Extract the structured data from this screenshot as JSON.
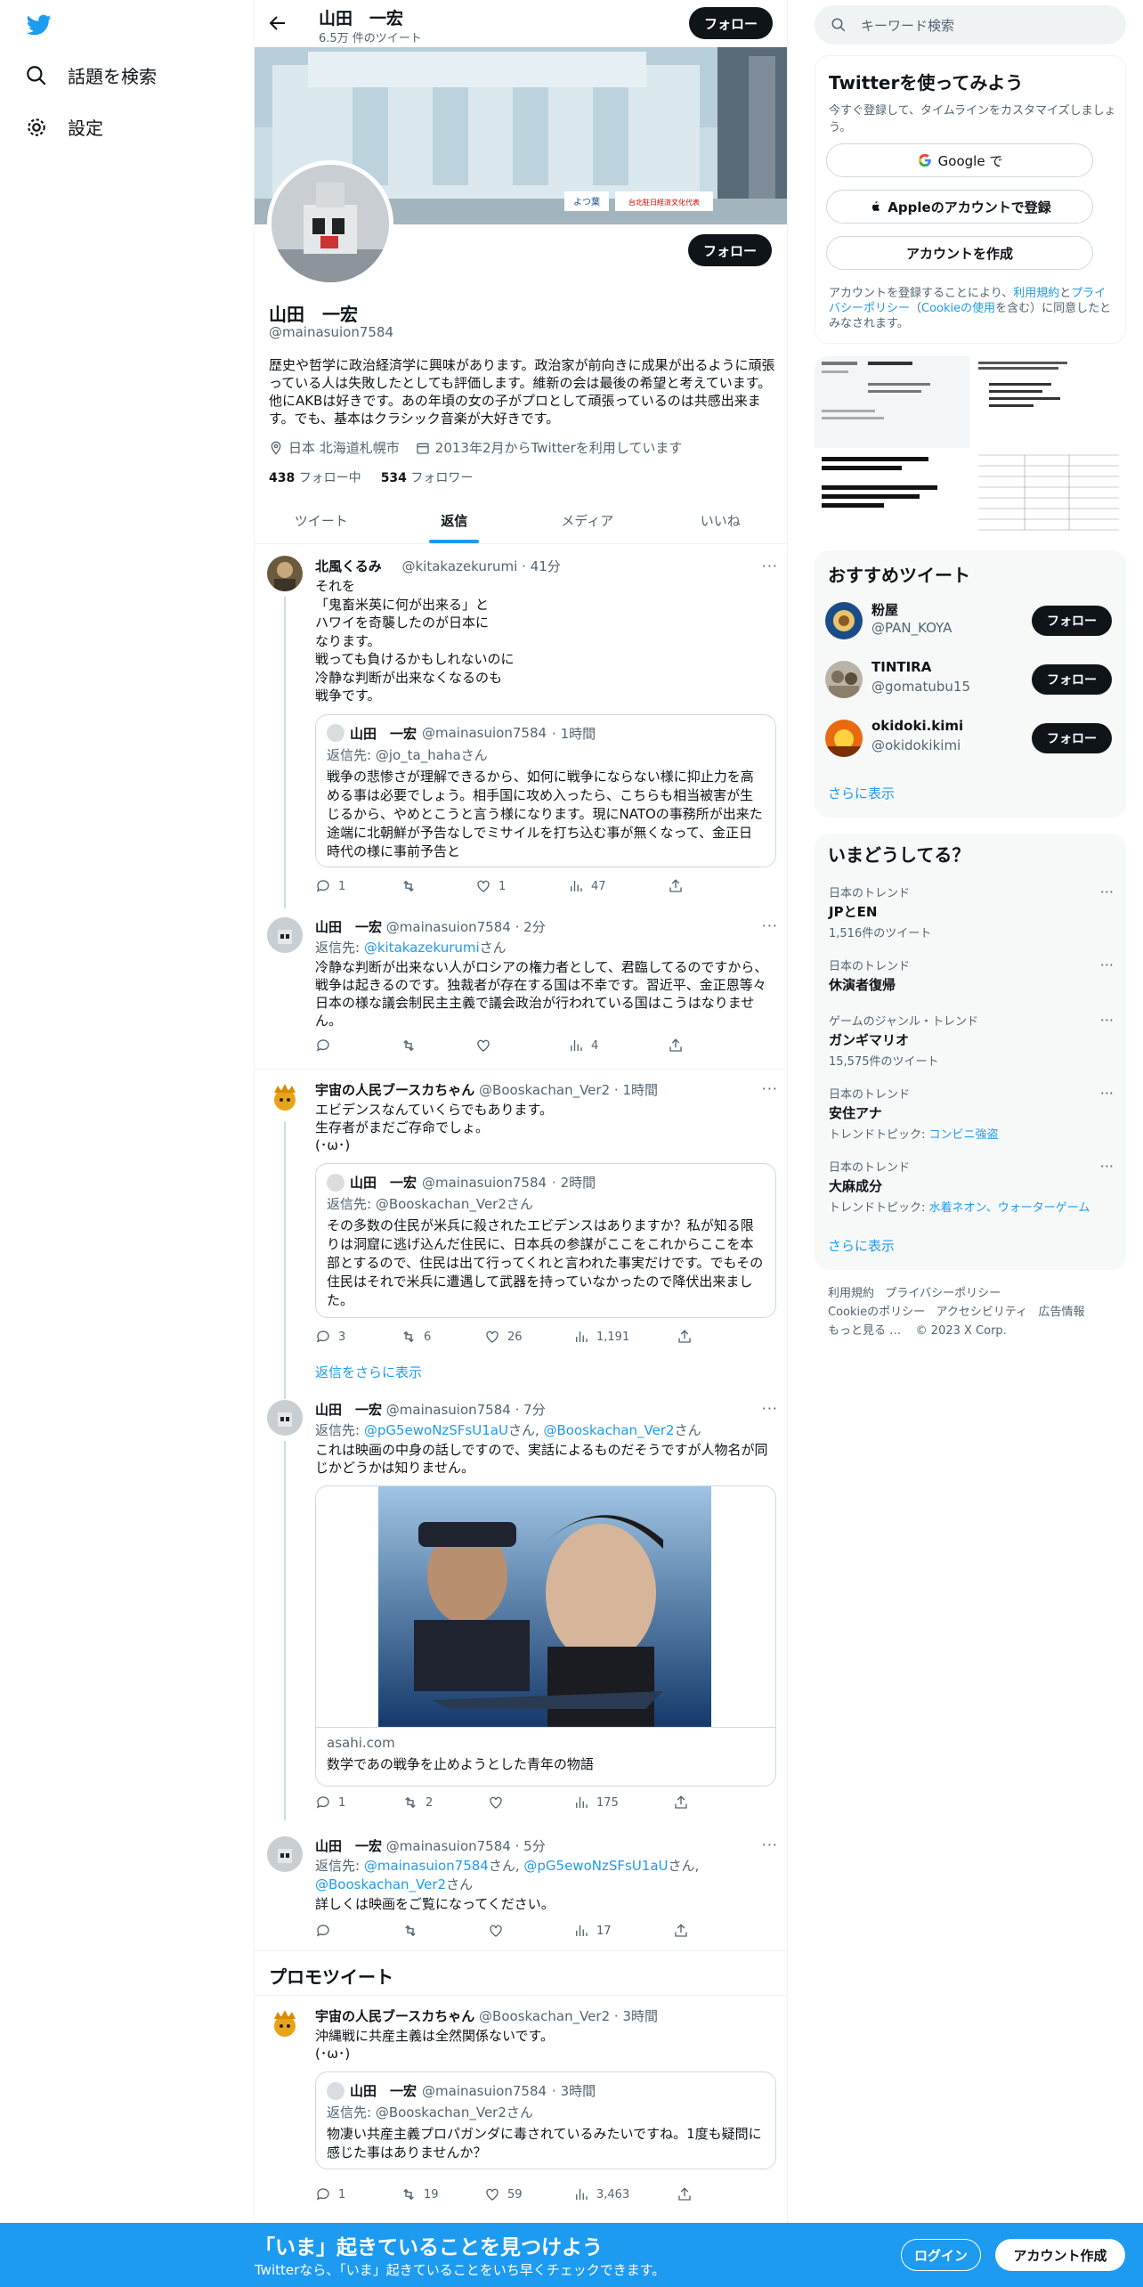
{
  "nav": {
    "explore_label": "話題を検索",
    "settings_label": "設定"
  },
  "topbar": {
    "name": "山田　一宏",
    "tweet_count": "6.5万 件のツイート",
    "follow_label": "フォロー"
  },
  "profile": {
    "name": "山田　一宏",
    "handle": "@mainasuion7584",
    "follow_label": "フォロー",
    "bio": "歴史や哲学に政治経済学に興味があります。政治家が前向きに成果が出るように頑張っている人は失敗したとしても評価します。維新の会は最後の希望と考えています。他にAKBは好きです。あの年頃の女の子がプロとして頑張っているのは共感出来ます。でも、基本はクラシック音楽が大好きです。",
    "location": "日本 北海道札幌市",
    "joined": "2013年2月からTwitterを利用しています",
    "following_count": "438",
    "following_label": "フォロー中",
    "followers_count": "534",
    "followers_label": "フォロワー",
    "banner_sign_1": "よつ葉",
    "banner_sign_2": "台北駐日経済文化代表"
  },
  "tabs": [
    "ツイート",
    "返信",
    "メディア",
    "いいね"
  ],
  "tweets": [
    {
      "name": "北風くるみ",
      "handle": "@kitakazekurumi",
      "time": "· 41分",
      "text": "それを\n「鬼畜米英に何が出来る」と\nハワイを奇襲したのが日本に\nなります。\n戦っても負けるかもしれないのに\n冷静な判断が出来なくなるのも\n戦争です。",
      "quote": {
        "name": "山田　一宏",
        "handle": "@mainasuion7584",
        "time": "· 1時間",
        "reply_to": "返信先: @jo_ta_hahaさん",
        "text": "戦争の悲惨さが理解できるから、如何に戦争にならない様に抑止力を高める事は必要でしょう。相手国に攻め入ったら、こちらも相当被害が生じるから、やめとこうと言う様になります。現にNATOの事務所が出来た途端に北朝鮮が予告なしでミサイルを打ち込む事が無くなって、金正日時代の様に事前予告と"
      },
      "replies": "1",
      "retweets": "",
      "likes": "1",
      "views": "47"
    },
    {
      "name": "山田　一宏",
      "handle": "@mainasuion7584",
      "time": "· 2分",
      "reply_prefix": "返信先: ",
      "reply_link": "@kitakazekurumi",
      "reply_suffix": "さん",
      "text": "冷静な判断が出来ない人がロシアの権力者として、君臨してるのですから、戦争は起きるのです。独裁者が存在する国は不幸です。習近平、金正恩等々日本の様な議会制民主主義で議会政治が行われている国はこうはなりません。",
      "replies": "",
      "retweets": "",
      "likes": "",
      "views": "4"
    },
    {
      "name": "宇宙の人民ブースカちゃん",
      "handle": "@Booskachan_Ver2",
      "time": "· 1時間",
      "text": "エビデンスなんていくらでもあります。\n生存者がまだご存命でしょ。\n(･ω･)",
      "quote": {
        "name": "山田　一宏",
        "handle": "@mainasuion7584",
        "time": "· 2時間",
        "reply_to": "返信先: @Booskachan_Ver2さん",
        "text": "その多数の住民が米兵に殺されたエビデンスはありますか？私が知る限りは洞窟に逃げ込んだ住民に、日本兵の参謀がここをこれからここを本部とするので、住民は出て行ってくれと言われた事実だけです。でもその住民はそれで米兵に遭遇して武器を持っていなかったので降伏出来ました。"
      },
      "replies": "3",
      "retweets": "6",
      "likes": "26",
      "views": "1,191"
    },
    {
      "name": "山田　一宏",
      "handle": "@mainasuion7584",
      "time": "· 7分",
      "reply_prefix": "返信先: ",
      "reply_link": "@pG5ewoNzSFsU1aU",
      "reply_mid": "さん, ",
      "reply_link2": "@Booskachan_Ver2",
      "reply_suffix": "さん",
      "text": "これは映画の中身の話しですので、実話によるものだそうですが人物名が同じかどうかは知りません。",
      "card_domain": "asahi.com",
      "card_title": "数学であの戦争を止めようとした青年の物語",
      "replies": "1",
      "retweets": "2",
      "likes": "",
      "views": "175"
    },
    {
      "name": "山田　一宏",
      "handle": "@mainasuion7584",
      "time": "· 5分",
      "reply_prefix": "返信先: ",
      "reply_link": "@mainasuion7584",
      "reply_mid": "さん, ",
      "reply_link2": "@pG5ewoNzSFsU1aU",
      "reply_mid2": "さん,",
      "reply_link3": "@Booskachan_Ver2",
      "reply_suffix": "さん",
      "text": "詳しくは映画をご覧になってください。",
      "replies": "",
      "retweets": "",
      "likes": "",
      "views": "17"
    },
    {
      "name": "宇宙の人民ブースカちゃん",
      "handle": "@Booskachan_Ver2",
      "time": "· 3時間",
      "text": "沖縄戦に共産主義は全然関係ないです。\n(･ω･)",
      "quote": {
        "name": "山田　一宏",
        "handle": "@mainasuion7584",
        "time": "· 3時間",
        "reply_to": "返信先: @Booskachan_Ver2さん",
        "text": "物凄い共産主義プロパガンダに毒されているみたいですね。1度も疑問に感じた事はありませんか？"
      },
      "replies": "1",
      "retweets": "19",
      "likes": "59",
      "views": "3,463"
    }
  ],
  "show_more_replies": "返信をさらに表示",
  "promo_heading": "プロモツイート",
  "right": {
    "search_placeholder": "キーワード検索",
    "signup_title": "Twitterを使ってみよう",
    "signup_sub": "今すぐ登録して、タイムラインをカスタマイズしましょう。",
    "google_label": "Google で",
    "apple_label": "Appleのアカウントで登録",
    "create_label": "アカウントを作成",
    "terms_1": "アカウントを登録することにより、",
    "terms_link_1": "利用規約",
    "terms_2": "と",
    "terms_link_2": "プライバシーポリシー",
    "terms_3": "（",
    "terms_link_3": "Cookieの使用",
    "terms_4": "を含む）に同意したとみなされます。",
    "rec_title": "おすすめツイート",
    "recs": [
      {
        "name": "粉屋",
        "handle": "@PAN_KOYA",
        "btn": "フォロー"
      },
      {
        "name": "TINTIRA",
        "handle": "@gomatubu15",
        "btn": "フォロー"
      },
      {
        "name": "okidoki.kimi",
        "handle": "@okidokikimi",
        "btn": "フォロー"
      }
    ],
    "show_more": "さらに表示",
    "trends_title": "いまどうしてる？",
    "trends": [
      {
        "cat": "日本のトレンド",
        "name": "JPとEN",
        "sub": "1,516件のツイート",
        "sub_link": "",
        "sub_link2": ""
      },
      {
        "cat": "日本のトレンド",
        "name": "休演者復帰",
        "sub": "",
        "sub_link": "",
        "sub_link2": ""
      },
      {
        "cat": "ゲームのジャンル・トレンド",
        "name": "ガンギマリオ",
        "sub": "15,575件のツイート",
        "sub_link": "",
        "sub_link2": ""
      },
      {
        "cat": "日本のトレンド",
        "name": "安住アナ",
        "sub": "トレンドトピック: ",
        "sub_link": "コンビニ強盗",
        "sub_link2": ""
      },
      {
        "cat": "日本のトレンド",
        "name": "大麻成分",
        "sub": "トレンドトピック: ",
        "sub_link": "水着ネオン",
        "sub_link2": "、ウォーターゲーム"
      }
    ],
    "trends_more": "さらに表示",
    "footer": [
      "利用規約",
      "プライバシーポリシー",
      "Cookieのポリシー",
      "アクセシビリティ",
      "広告情報",
      "もっと見る …",
      "© 2023 X Corp."
    ]
  },
  "bottom": {
    "title": "「いま」起きていることを見つけよう",
    "sub": "Twitterなら、「いま」起きていることをいち早くチェックできます。",
    "login": "ログイン",
    "signup": "アカウント作成"
  }
}
